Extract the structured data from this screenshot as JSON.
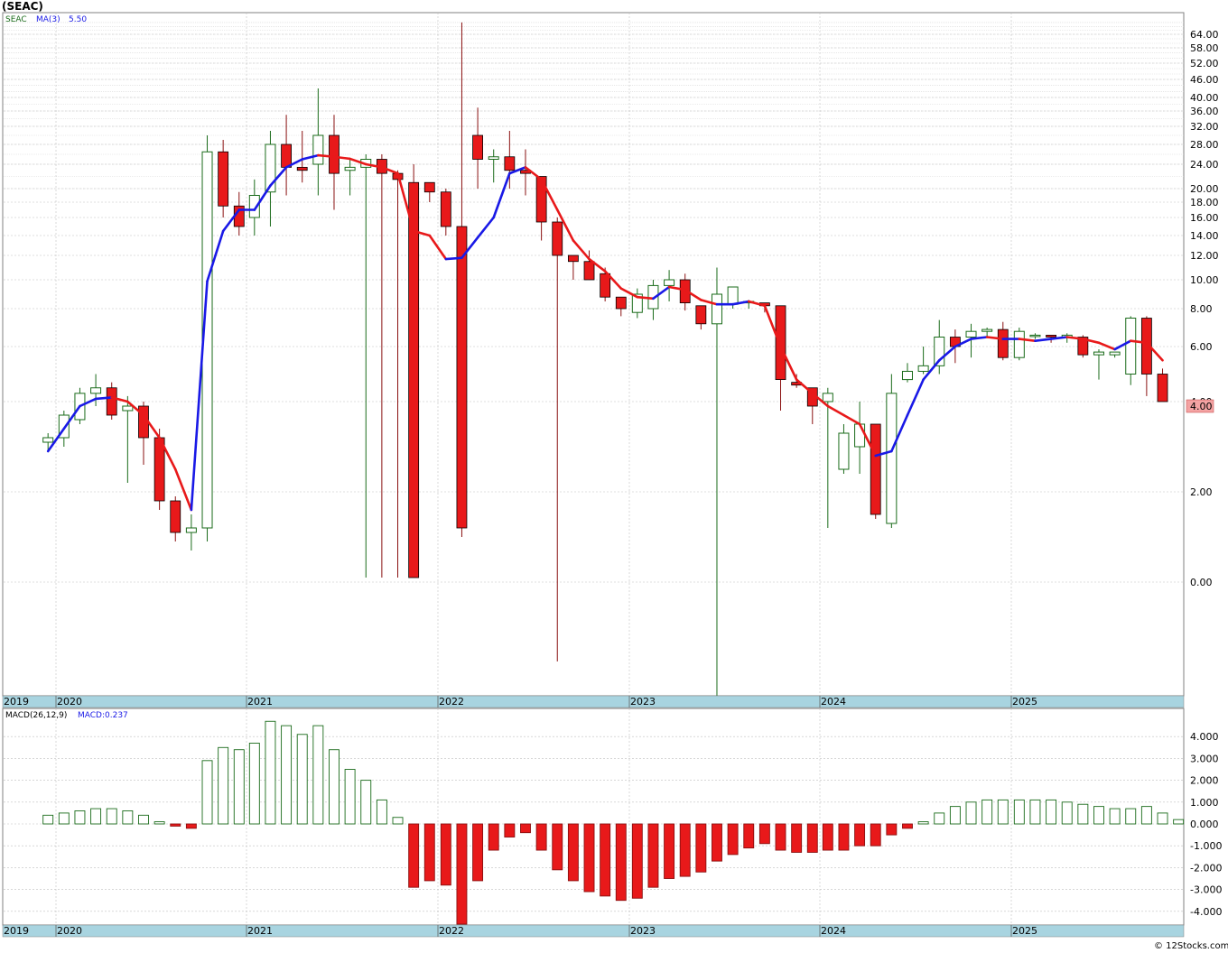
{
  "title": "(SEAC)",
  "ticker": "SEAC",
  "ma_label": "MA(3)",
  "ma_value": "5.50",
  "last_price_tag": "4.00",
  "macd_label": "MACD(26,12,9)",
  "macd_value": "MACD:0.237",
  "watermark": "© 12Stocks.com",
  "colors": {
    "up": "#1a6b1a",
    "down": "#e8191a",
    "ma_up": "#1919e6",
    "ma_down": "#e8191a",
    "axis_band": "#a8d4e0",
    "price_tag_bg": "#f4a3a3",
    "grid": "#c0c0c0"
  },
  "year_labels": [
    "2019",
    "2020",
    "2021",
    "2022",
    "2023",
    "2024",
    "2025"
  ],
  "chart_data": [
    {
      "type": "candlestick",
      "interval": "monthly",
      "scale": "custom (compressed)",
      "y_ticks": [
        0.0,
        2.0,
        4.0,
        6.0,
        8.0,
        10.0,
        12.0,
        14.0,
        16.0,
        18.0,
        20.0,
        24.0,
        28.0,
        32.0,
        36.0,
        40.0,
        46.0,
        52.0,
        58.0,
        64.0
      ],
      "x": [
        "2019-12",
        "2020-01",
        "2020-02",
        "2020-03",
        "2020-04",
        "2020-05",
        "2020-06",
        "2020-07",
        "2020-08",
        "2020-09",
        "2020-10",
        "2020-11",
        "2020-12",
        "2021-01",
        "2021-02",
        "2021-03",
        "2021-04",
        "2021-05",
        "2021-06",
        "2021-07",
        "2021-08",
        "2021-09",
        "2021-10",
        "2021-11",
        "2021-12",
        "2022-01",
        "2022-02",
        "2022-03",
        "2022-04",
        "2022-05",
        "2022-06",
        "2022-07",
        "2022-08",
        "2022-09",
        "2022-10",
        "2022-11",
        "2022-12",
        "2023-01",
        "2023-02",
        "2023-03",
        "2023-04",
        "2023-05",
        "2023-06",
        "2023-07",
        "2023-08",
        "2023-09",
        "2023-10",
        "2023-11",
        "2023-12",
        "2024-01",
        "2024-02",
        "2024-03",
        "2024-04",
        "2024-05",
        "2024-06",
        "2024-07",
        "2024-08",
        "2024-09",
        "2024-10",
        "2024-11",
        "2024-12",
        "2025-01",
        "2025-02",
        "2025-03",
        "2025-04",
        "2025-05",
        "2025-06",
        "2025-07",
        "2025-08",
        "2025-09",
        "2025-10",
        "2025-11",
        "2025-12",
        "2026-01"
      ],
      "ohlc": [
        [
          3.1,
          3.3,
          2.9,
          3.2
        ],
        [
          3.2,
          3.8,
          3.0,
          3.7
        ],
        [
          3.6,
          4.5,
          3.5,
          4.3
        ],
        [
          4.3,
          5.0,
          3.9,
          4.5
        ],
        [
          4.5,
          4.7,
          3.6,
          3.7
        ],
        [
          3.8,
          4.2,
          2.2,
          3.9
        ],
        [
          3.9,
          4.0,
          2.6,
          3.2
        ],
        [
          3.2,
          3.4,
          1.6,
          1.8
        ],
        [
          1.8,
          1.9,
          0.9,
          1.1
        ],
        [
          1.1,
          1.5,
          0.7,
          1.2
        ],
        [
          1.2,
          30,
          0.9,
          26.5
        ],
        [
          26.5,
          29,
          16,
          17.5
        ],
        [
          17.5,
          19.5,
          14,
          15
        ],
        [
          16,
          21.5,
          14,
          19
        ],
        [
          19.5,
          31,
          15,
          28
        ],
        [
          28,
          35,
          19,
          23.5
        ],
        [
          23.5,
          31,
          21,
          23
        ],
        [
          24,
          43,
          19,
          30
        ],
        [
          30,
          35,
          17,
          22.5
        ],
        [
          23,
          25,
          19,
          23.5
        ],
        [
          23.5,
          26,
          0.1,
          25
        ],
        [
          25,
          26,
          0.1,
          22.5
        ],
        [
          22.5,
          23,
          0.1,
          21.5
        ],
        [
          21,
          24,
          0.1,
          0.1
        ],
        [
          21,
          21,
          18,
          19.5
        ],
        [
          19.5,
          20,
          14,
          15
        ],
        [
          15,
          70,
          1.0,
          1.2
        ],
        [
          30,
          37,
          20,
          25
        ],
        [
          25,
          27,
          21,
          25.5
        ],
        [
          25.5,
          31,
          20,
          23
        ],
        [
          23,
          27,
          19,
          22.5
        ],
        [
          22,
          21.5,
          13.5,
          15.5
        ],
        [
          15.5,
          16,
          -1.7,
          12
        ],
        [
          12,
          12,
          10,
          11.5
        ],
        [
          11.5,
          12.5,
          10,
          10
        ],
        [
          10.5,
          11,
          8.5,
          8.8
        ],
        [
          8.8,
          8.8,
          7.6,
          8
        ],
        [
          7.8,
          9.4,
          7.5,
          9
        ],
        [
          8,
          10,
          7.4,
          9.6
        ],
        [
          9.6,
          10.8,
          8.5,
          10
        ],
        [
          10,
          10.5,
          7.9,
          8.4
        ],
        [
          8.2,
          8.2,
          6.9,
          7.2
        ],
        [
          7.2,
          11,
          -2.5,
          9
        ],
        [
          8.3,
          9.5,
          8,
          9.5
        ],
        [
          8.4,
          8.6,
          8,
          8.5
        ],
        [
          8.4,
          8.2,
          7.8,
          8.2
        ],
        [
          8.2,
          8.2,
          3.8,
          4.8
        ],
        [
          4.7,
          5.0,
          4.5,
          4.6
        ],
        [
          4.5,
          4.5,
          3.5,
          3.9
        ],
        [
          4.0,
          4.5,
          1.2,
          4.3
        ],
        [
          2.5,
          3.5,
          2.4,
          3.3
        ],
        [
          3.0,
          4.0,
          2.4,
          3.5
        ],
        [
          3.5,
          3.5,
          1.4,
          1.5
        ],
        [
          1.3,
          5.0,
          1.2,
          4.3
        ],
        [
          4.8,
          5.4,
          4.7,
          5.1
        ],
        [
          5.1,
          6.0,
          5.0,
          5.3
        ],
        [
          5.3,
          7.4,
          5.0,
          6.5
        ],
        [
          6.5,
          6.9,
          5.4,
          6.0
        ],
        [
          6.5,
          7.2,
          5.6,
          6.8
        ],
        [
          6.8,
          7.0,
          6.5,
          6.9
        ],
        [
          6.9,
          7.3,
          5.5,
          5.6
        ],
        [
          5.6,
          7.0,
          5.5,
          6.8
        ],
        [
          6.6,
          6.7,
          6.4,
          6.6
        ],
        [
          6.6,
          6.5,
          6.2,
          6.5
        ],
        [
          6.5,
          6.7,
          6.2,
          6.6
        ],
        [
          6.5,
          6.6,
          5.6,
          5.7
        ],
        [
          5.7,
          5.9,
          4.8,
          5.8
        ],
        [
          5.7,
          5.8,
          5.6,
          5.8
        ],
        [
          5.0,
          7.6,
          4.6,
          7.5
        ],
        [
          7.5,
          7.6,
          4.2,
          5.0
        ],
        [
          5.0,
          5.2,
          4.0,
          4.0
        ]
      ],
      "ma3": [
        2.9,
        3.4,
        3.9,
        4.1,
        4.15,
        4.0,
        3.7,
        3.2,
        2.5,
        1.6,
        9.9,
        14.5,
        17.0,
        17.0,
        20.5,
        23.5,
        25.0,
        25.8,
        25.5,
        25.1,
        24.0,
        23.5,
        22.5,
        14.5,
        14.0,
        11.7,
        11.8,
        13.8,
        16.0,
        22.5,
        23.5,
        21.5,
        17.0,
        13.5,
        11.7,
        10.7,
        9.4,
        8.8,
        8.7,
        9.5,
        9.3,
        8.6,
        8.3,
        8.3,
        8.5,
        8.2,
        6.0,
        4.8,
        4.3,
        3.9,
        3.7,
        3.5,
        2.8,
        2.9,
        3.7,
        4.8,
        5.5,
        6.0,
        6.4,
        6.5,
        6.4,
        6.4,
        6.3,
        6.4,
        6.5,
        6.4,
        6.2,
        5.9,
        6.3,
        6.2,
        5.5
      ],
      "macd": [
        0.4,
        0.5,
        0.6,
        0.7,
        0.7,
        0.6,
        0.4,
        0.1,
        -0.1,
        -0.2,
        2.9,
        3.5,
        3.4,
        3.7,
        4.7,
        4.5,
        4.1,
        4.5,
        3.4,
        2.5,
        2.0,
        1.1,
        0.3,
        -2.9,
        -2.6,
        -2.8,
        -4.7,
        -2.6,
        -1.2,
        -0.6,
        -0.4,
        -1.2,
        -2.1,
        -2.6,
        -3.1,
        -3.3,
        -3.5,
        -3.4,
        -2.9,
        -2.5,
        -2.4,
        -2.2,
        -1.7,
        -1.4,
        -1.1,
        -0.9,
        -1.2,
        -1.3,
        -1.3,
        -1.2,
        -1.2,
        -1.0,
        -1.0,
        -0.5,
        -0.2,
        0.1,
        0.5,
        0.8,
        1.0,
        1.1,
        1.1,
        1.1,
        1.1,
        1.1,
        1.0,
        0.9,
        0.8,
        0.7,
        0.7,
        0.8,
        0.5,
        0.2
      ]
    },
    {
      "type": "bar",
      "name": "MACD(26,12,9)",
      "y_ticks": [
        -4.0,
        -3.0,
        -2.0,
        -1.0,
        0.0,
        1.0,
        2.0,
        3.0,
        4.0
      ],
      "ylim": [
        -4.7,
        4.8
      ]
    }
  ]
}
